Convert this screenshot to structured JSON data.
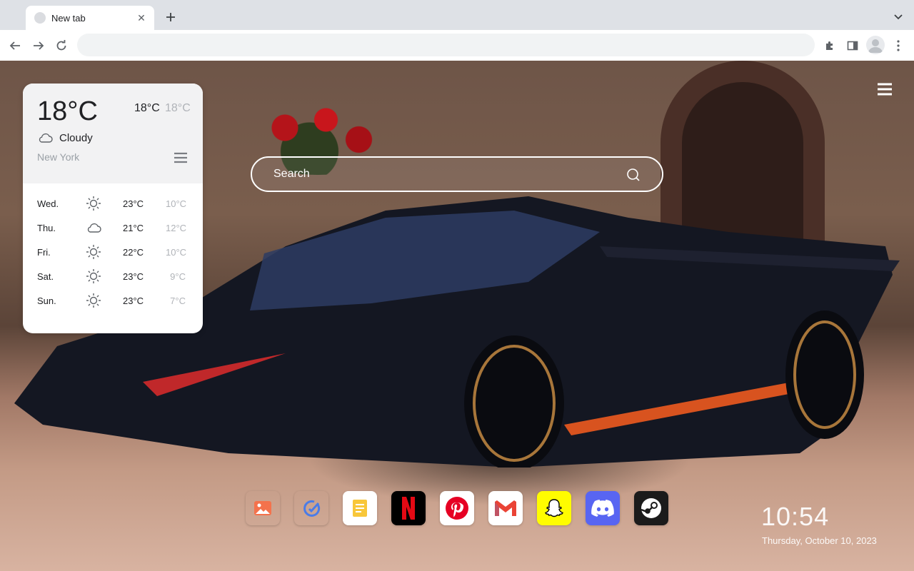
{
  "browser": {
    "tab": {
      "title": "New tab",
      "close_glyph": "✕"
    },
    "new_tab_glyph": "+",
    "omnibox": {
      "value": "",
      "placeholder": ""
    }
  },
  "weather": {
    "current_temp": "18°C",
    "high": "18°C",
    "low": "18°C",
    "condition": "Cloudy",
    "condition_icon": "cloud-icon",
    "city": "New York",
    "forecast": [
      {
        "day": "Wed.",
        "icon": "sun-icon",
        "high": "23°C",
        "low": "10°C"
      },
      {
        "day": "Thu.",
        "icon": "cloud-icon",
        "high": "21°C",
        "low": "12°C"
      },
      {
        "day": "Fri.",
        "icon": "sun-icon",
        "high": "22°C",
        "low": "10°C"
      },
      {
        "day": "Sat.",
        "icon": "sun-icon",
        "high": "23°C",
        "low": "9°C"
      },
      {
        "day": "Sun.",
        "icon": "sun-icon",
        "high": "23°C",
        "low": "7°C"
      }
    ]
  },
  "search": {
    "placeholder": "Search"
  },
  "dock": [
    {
      "name": "photos",
      "icon": "image-icon",
      "bg": "#ffffff"
    },
    {
      "name": "tasks",
      "icon": "check-circle-icon",
      "bg": "#ffffff"
    },
    {
      "name": "notes",
      "icon": "notes-icon",
      "bg": "#ffffff"
    },
    {
      "name": "netflix",
      "icon": "netflix-icon",
      "bg": "#000000"
    },
    {
      "name": "pinterest",
      "icon": "pinterest-icon",
      "bg": "#ffffff"
    },
    {
      "name": "gmail",
      "icon": "gmail-icon",
      "bg": "#ffffff"
    },
    {
      "name": "snapchat",
      "icon": "snapchat-icon",
      "bg": "#fffc00"
    },
    {
      "name": "discord",
      "icon": "discord-icon",
      "bg": "#5865f2"
    },
    {
      "name": "steam",
      "icon": "steam-icon",
      "bg": "#1b1b1b"
    }
  ],
  "clock": {
    "time": "10:54",
    "date": "Thursday, October 10, 2023"
  }
}
